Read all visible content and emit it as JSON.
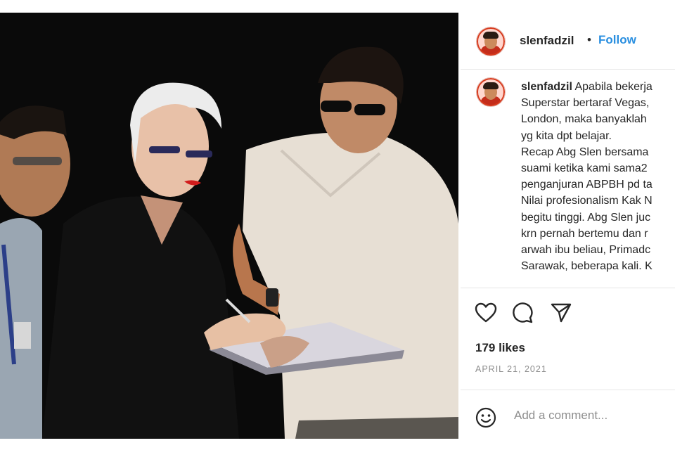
{
  "post": {
    "username": "slenfadzil",
    "separator": "•",
    "follow_label": "Follow",
    "caption_lines": [
      "Apabila bekerja",
      "Superstar bertaraf Vegas,",
      "London, maka banyaklah",
      "yg kita dpt belajar.",
      "Recap Abg Slen bersama",
      "suami ketika kami sama2",
      "penganjuran ABPBH pd ta",
      "Nilai profesionalism Kak N",
      "begitu tinggi. Abg Slen juc",
      "krn pernah bertemu dan r",
      "arwah ibu beliau, Primadc",
      "Sarawak, beberapa kali. K"
    ],
    "likes": "179 likes",
    "date": "APRIL 21, 2021",
    "comment_placeholder": "Add a comment..."
  },
  "icons": {
    "like": "heart-icon",
    "comment": "comment-bubble-icon",
    "share": "paper-plane-icon",
    "emoji": "smiley-icon"
  },
  "colors": {
    "accent": "#2a8fe0",
    "text": "#262626",
    "muted": "#8e8e8e",
    "photo_background": "#0a0a0a"
  }
}
